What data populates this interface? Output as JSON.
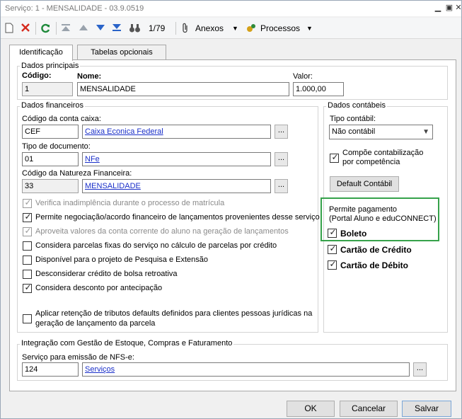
{
  "window": {
    "title": "Serviço: 1 - MENSALIDADE - 03.9.0519"
  },
  "toolbar": {
    "counter": "1/79",
    "attachments_label": "Anexos",
    "processes_label": "Processos"
  },
  "tabs": [
    {
      "label": "Identificação",
      "active": true
    },
    {
      "label": "Tabelas opcionais",
      "active": false
    }
  ],
  "dados_principais": {
    "title": "Dados principais",
    "codigo_label": "Código:",
    "codigo_value": "1",
    "nome_label": "Nome:",
    "nome_value": "MENSALIDADE",
    "valor_label": "Valor:",
    "valor_value": "1.000,00"
  },
  "dados_financeiros": {
    "title": "Dados financeiros",
    "conta_caixa_label": "Código da conta caixa:",
    "conta_caixa_code": "CEF",
    "conta_caixa_desc": "Caixa Econica Federal",
    "tipo_doc_label": "Tipo de documento:",
    "tipo_doc_code": "01",
    "tipo_doc_desc": "NFe",
    "natureza_label": "Código da Natureza Financeira:",
    "natureza_code": "33",
    "natureza_desc": "MENSALIDADE",
    "options": [
      {
        "label": "Verifica inadimplência durante o processo de matrícula",
        "checked": true,
        "disabled": true
      },
      {
        "label": "Permite negociação/acordo financeiro de lançamentos provenientes desse serviço",
        "checked": true,
        "disabled": false
      },
      {
        "label": "Aproveita valores da conta corrente do aluno na geração de lançamentos",
        "checked": true,
        "disabled": true
      },
      {
        "label": "Considera parcelas fixas do serviço no cálculo de parcelas por crédito",
        "checked": false,
        "disabled": false
      },
      {
        "label": "Disponível para o projeto de Pesquisa e Extensão",
        "checked": false,
        "disabled": false
      },
      {
        "label": "Desconsiderar crédito de bolsa retroativa",
        "checked": false,
        "disabled": false
      },
      {
        "label": "Considera desconto por antecipação",
        "checked": true,
        "disabled": false
      }
    ],
    "retencao_line1": "Aplicar retenção de tributos defaults definidos para clientes pessoas jurídicas na",
    "retencao_line2": "geração de lançamento da parcela"
  },
  "dados_contabeis": {
    "title": "Dados contábeis",
    "tipo_label": "Tipo contábil:",
    "tipo_value": "Não contábil",
    "compoe_line1": "Compõe contabilização",
    "compoe_line2": "por competência",
    "default_button": "Default Contábil"
  },
  "permite_pagamento": {
    "title": "Permite pagamento",
    "subtitle": "(Portal Aluno e eduCONNECT)",
    "options": [
      {
        "label": "Boleto",
        "checked": true
      },
      {
        "label": "Cartão de Crédito",
        "checked": true
      },
      {
        "label": "Cartão de Débito",
        "checked": true
      }
    ]
  },
  "integracao": {
    "title": "Integração com Gestão de Estoque, Compras e Faturamento",
    "servico_label": "Serviço para emissão de NFS-e:",
    "servico_code": "124",
    "servico_desc": "Serviços"
  },
  "buttons": {
    "ok": "OK",
    "cancel": "Cancelar",
    "save": "Salvar"
  },
  "colors": {
    "highlight": "#36a24b",
    "link": "#1a2fc9"
  }
}
